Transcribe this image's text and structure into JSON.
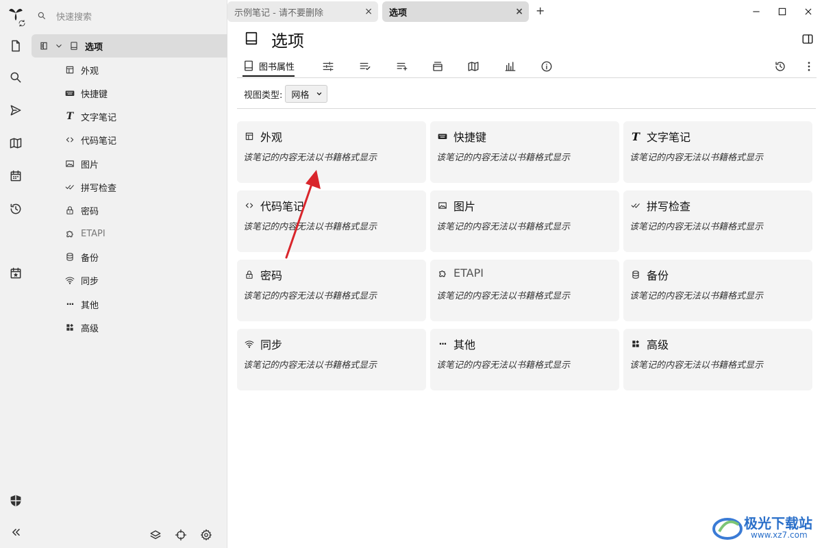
{
  "search": {
    "placeholder": "快速搜索"
  },
  "tree": {
    "root_label": "选项",
    "children": [
      {
        "label": "外观",
        "icon": "layout-icon"
      },
      {
        "label": "快捷键",
        "icon": "keyboard-icon"
      },
      {
        "label": "文字笔记",
        "icon": "text-icon"
      },
      {
        "label": "代码笔记",
        "icon": "code-icon"
      },
      {
        "label": "图片",
        "icon": "image-icon"
      },
      {
        "label": "拼写检查",
        "icon": "spellcheck-icon"
      },
      {
        "label": "密码",
        "icon": "lock-icon"
      },
      {
        "label": "ETAPI",
        "icon": "puzzle-icon"
      },
      {
        "label": "备份",
        "icon": "database-icon"
      },
      {
        "label": "同步",
        "icon": "wifi-icon"
      },
      {
        "label": "其他",
        "icon": "dots-icon"
      },
      {
        "label": "高级",
        "icon": "widgets-icon"
      }
    ]
  },
  "tabs": [
    {
      "label": "示例笔记 - 请不要删除",
      "close": "×"
    },
    {
      "label": "选项",
      "close": "×"
    }
  ],
  "new_tab": "+",
  "note": {
    "title": "选项"
  },
  "ribbon": {
    "active_label": "图书属性"
  },
  "view_type": {
    "label": "视图类型:",
    "value": "网格"
  },
  "cards": {
    "description": "该笔记的内容无法以书籍格式显示",
    "items": [
      {
        "label": "外观"
      },
      {
        "label": "快捷键"
      },
      {
        "label": "文字笔记"
      },
      {
        "label": "代码笔记"
      },
      {
        "label": "图片"
      },
      {
        "label": "拼写检查"
      },
      {
        "label": "密码"
      },
      {
        "label": "ETAPI"
      },
      {
        "label": "备份"
      },
      {
        "label": "同步"
      },
      {
        "label": "其他"
      },
      {
        "label": "高级"
      }
    ]
  },
  "glyphs": {
    "text_icon": "T",
    "dots_icon": "···",
    "code_icon": "‹›"
  },
  "watermark": {
    "name": "极光下载站",
    "url": "www.xz7.com"
  },
  "colors": {
    "panel_bg": "#f1f1f1",
    "selected_bg": "#dcdcdc",
    "card_bg": "#f4f4f4",
    "arrow": "#d9252b"
  }
}
